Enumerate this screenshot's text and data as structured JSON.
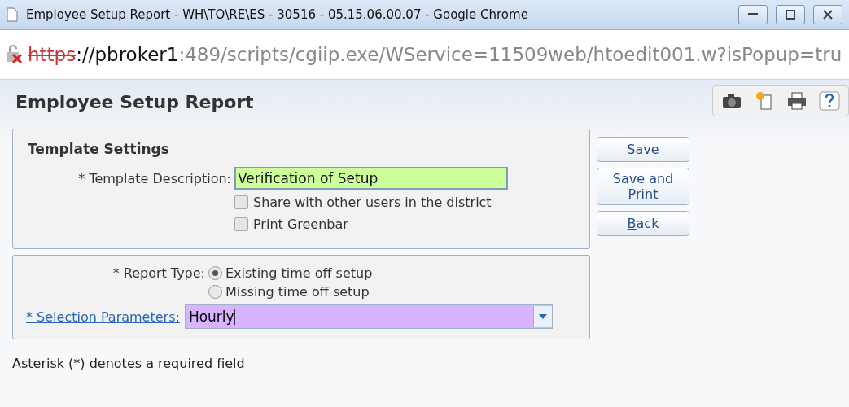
{
  "window": {
    "title": "Employee Setup Report - WH\\TO\\RE\\ES - 30516 - 05.15.06.00.07 - Google Chrome"
  },
  "address": {
    "scheme": "https",
    "host": "://pbroker1",
    "path": ":489/scripts/cgiip.exe/WService=11509web/htoedit001.w?isPopup=tru"
  },
  "page": {
    "title": "Employee Setup Report"
  },
  "template_settings": {
    "heading": "Template Settings",
    "description_label": "* Template Description:",
    "description_value": "Verification of Setup",
    "checkboxes": [
      {
        "label": "Share with other users in the district",
        "checked": false
      },
      {
        "label": "Print Greenbar",
        "checked": false
      }
    ]
  },
  "report": {
    "type_label": "* Report Type:",
    "types": [
      {
        "label": "Existing time off setup",
        "selected": true
      },
      {
        "label": "Missing time off setup",
        "selected": false
      }
    ],
    "selection_label": "* Selection Parameters:",
    "selection_value": "Hourly"
  },
  "buttons": [
    {
      "accel": "S",
      "rest": "ave"
    },
    {
      "rest": "Save and Print"
    },
    {
      "accel": "B",
      "rest": "ack"
    }
  ],
  "footer": "Asterisk (*) denotes a required field"
}
